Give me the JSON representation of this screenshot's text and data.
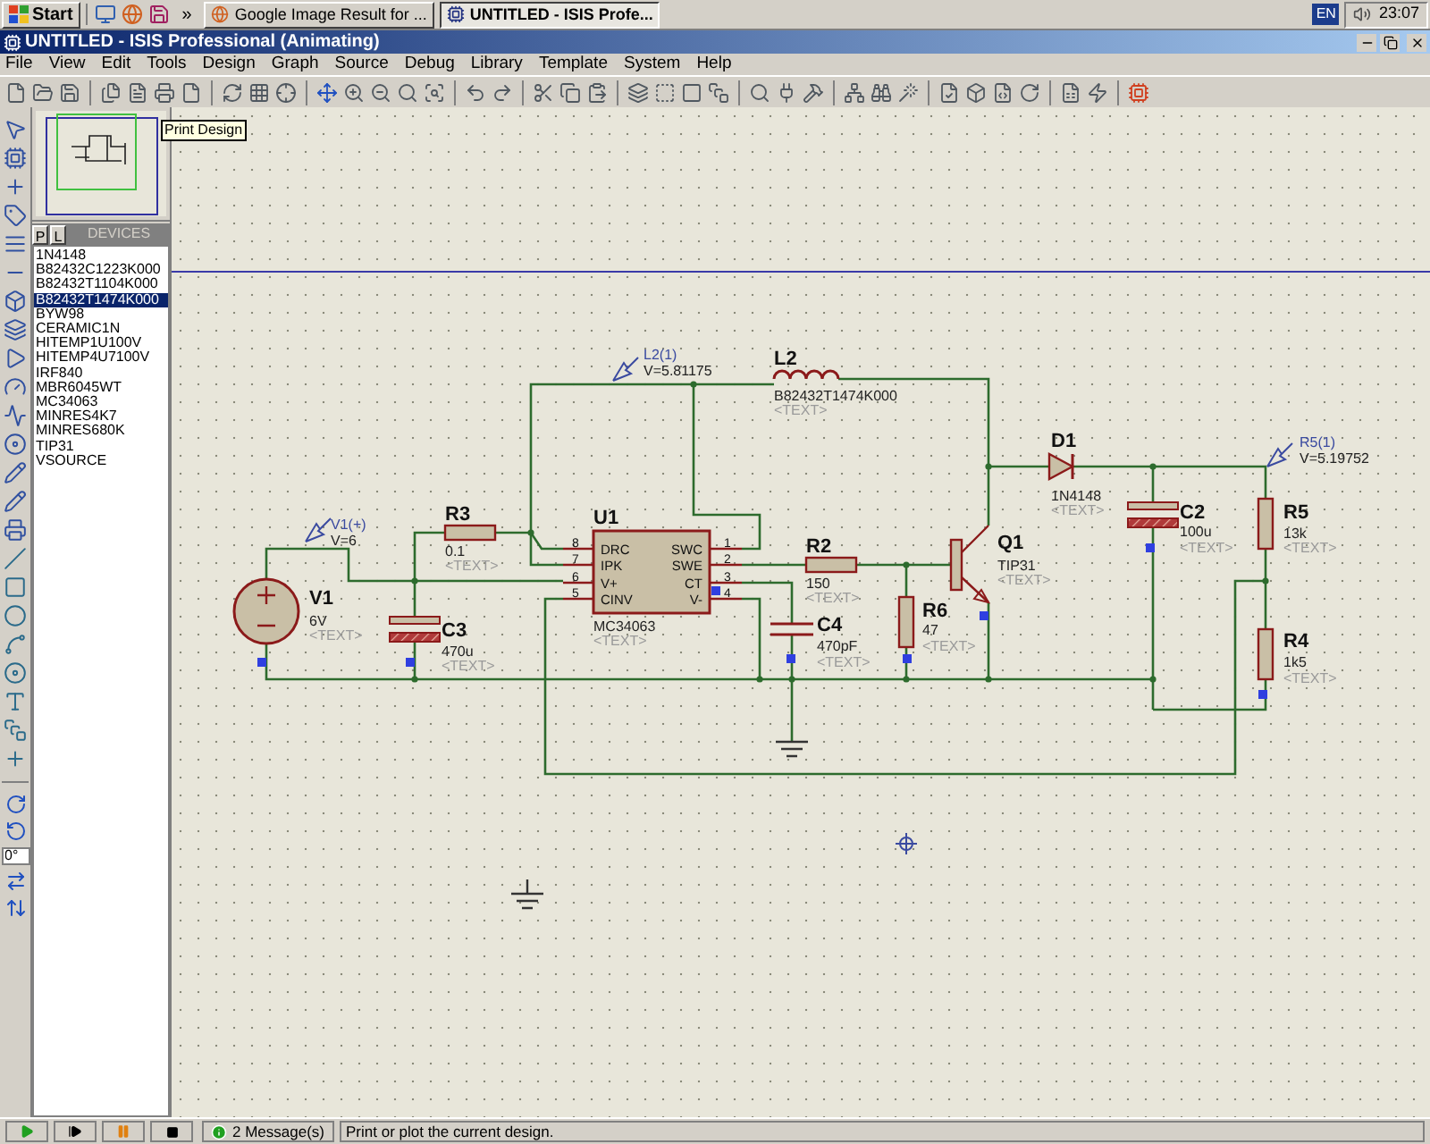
{
  "taskbar": {
    "start": "Start",
    "more": "»",
    "tasks": [
      {
        "label": "Google Image Result for ...",
        "selected": false
      },
      {
        "label": "UNTITLED - ISIS Profe...",
        "selected": true
      }
    ],
    "language": "EN",
    "clock": "23:07"
  },
  "window": {
    "title": "UNTITLED - ISIS Professional (Animating)"
  },
  "menu": [
    "File",
    "View",
    "Edit",
    "Tools",
    "Design",
    "Graph",
    "Source",
    "Debug",
    "Library",
    "Template",
    "System",
    "Help"
  ],
  "tooltip": "Print Design",
  "device_panel": {
    "tabs": [
      {
        "label": "P",
        "selected": false
      },
      {
        "label": "L",
        "selected": false
      }
    ],
    "title": "DEVICES",
    "items": [
      {
        "label": "1N4148",
        "selected": false
      },
      {
        "label": "B82432C1223K000",
        "selected": false
      },
      {
        "label": "B82432T1104K000",
        "selected": false
      },
      {
        "label": "B82432T1474K000",
        "selected": true
      },
      {
        "label": "BYW98",
        "selected": false
      },
      {
        "label": "CERAMIC1N",
        "selected": false
      },
      {
        "label": "HITEMP1U100V",
        "selected": false
      },
      {
        "label": "HITEMP4U7100V",
        "selected": false
      },
      {
        "label": "IRF840",
        "selected": false
      },
      {
        "label": "MBR6045WT",
        "selected": false
      },
      {
        "label": "MC34063",
        "selected": false
      },
      {
        "label": "MINRES4K7",
        "selected": false
      },
      {
        "label": "MINRES680K",
        "selected": false
      },
      {
        "label": "TIP31",
        "selected": false
      },
      {
        "label": "VSOURCE",
        "selected": false
      }
    ]
  },
  "rotation_field": {
    "value": "0°"
  },
  "schematic": {
    "components": [
      {
        "kind": "source",
        "ref": "V1",
        "value": "6V",
        "text": "<TEXT>"
      },
      {
        "kind": "resistor",
        "ref": "R3",
        "value": "0.1",
        "text": "<TEXT>"
      },
      {
        "kind": "electrolytic",
        "ref": "C3",
        "value": "470u",
        "text": "<TEXT>"
      },
      {
        "kind": "inductor",
        "ref": "L2",
        "value": "B82432T1474K000",
        "text": "<TEXT>"
      },
      {
        "kind": "resistor",
        "ref": "R2",
        "value": "150",
        "text": "<TEXT>"
      },
      {
        "kind": "capacitor",
        "ref": "C4",
        "value": "470pF",
        "text": "<TEXT>"
      },
      {
        "kind": "resistor",
        "ref": "R6",
        "value": "47",
        "text": "<TEXT>"
      },
      {
        "kind": "transistor",
        "ref": "Q1",
        "value": "TIP31",
        "text": "<TEXT>"
      },
      {
        "kind": "diode",
        "ref": "D1",
        "value": "1N4148",
        "text": "<TEXT>"
      },
      {
        "kind": "electrolytic",
        "ref": "C2",
        "value": "100u",
        "text": "<TEXT>"
      },
      {
        "kind": "resistor",
        "ref": "R5",
        "value": "13k",
        "text": "<TEXT>"
      },
      {
        "kind": "resistor",
        "ref": "R4",
        "value": "1k5",
        "text": "<TEXT>"
      }
    ],
    "ic": {
      "ref": "U1",
      "part": "MC34063",
      "text": "<TEXT>",
      "left_pins": [
        {
          "number": "8",
          "name": "DRC"
        },
        {
          "number": "7",
          "name": "IPK"
        },
        {
          "number": "6",
          "name": "V+"
        },
        {
          "number": "5",
          "name": "CINV"
        }
      ],
      "right_pins": [
        {
          "number": "1",
          "name": "SWC"
        },
        {
          "number": "2",
          "name": "SWE"
        },
        {
          "number": "3",
          "name": "CT"
        },
        {
          "number": "4",
          "name": "V-"
        }
      ]
    },
    "probes": [
      {
        "name": "V1(+)",
        "reading": "V=6"
      },
      {
        "name": "L2(1)",
        "reading": "V=5.81175"
      },
      {
        "name": "R5(1)",
        "reading": "V=5.19752"
      }
    ]
  },
  "status_bar": {
    "messages": "2 Message(s)",
    "text": "Print or plot the current design."
  }
}
